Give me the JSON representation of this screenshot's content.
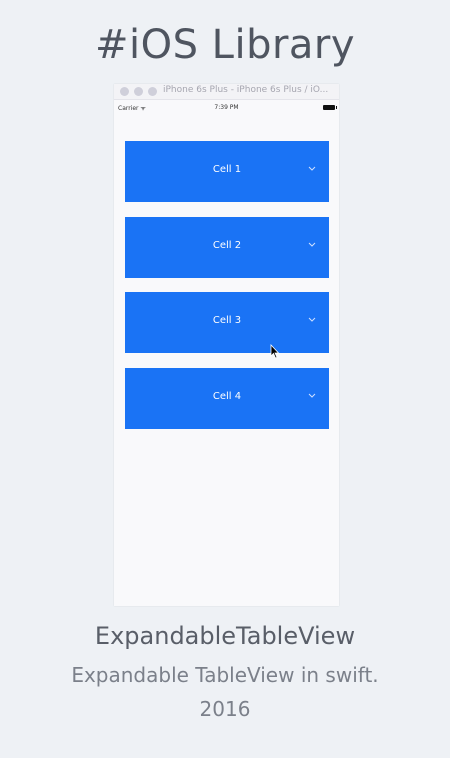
{
  "page": {
    "title": "#iOS Library"
  },
  "simulator": {
    "window_title": "iPhone 6s Plus - iPhone 6s Plus / iO...",
    "status_bar": {
      "carrier": "Carrier ᯤ",
      "time": "7:39 PM"
    }
  },
  "table": {
    "cells": [
      {
        "label": "Cell 1",
        "icon": "chevron-down-icon"
      },
      {
        "label": "Cell 2",
        "icon": "chevron-down-icon"
      },
      {
        "label": "Cell 3",
        "icon": "chevron-down-icon"
      },
      {
        "label": "Cell 4",
        "icon": "chevron-down-icon"
      }
    ],
    "cell_color": "#1a73f5"
  },
  "library": {
    "name": "ExpandableTableView",
    "description": "Expandable TableView in swift.",
    "year": "2016"
  }
}
